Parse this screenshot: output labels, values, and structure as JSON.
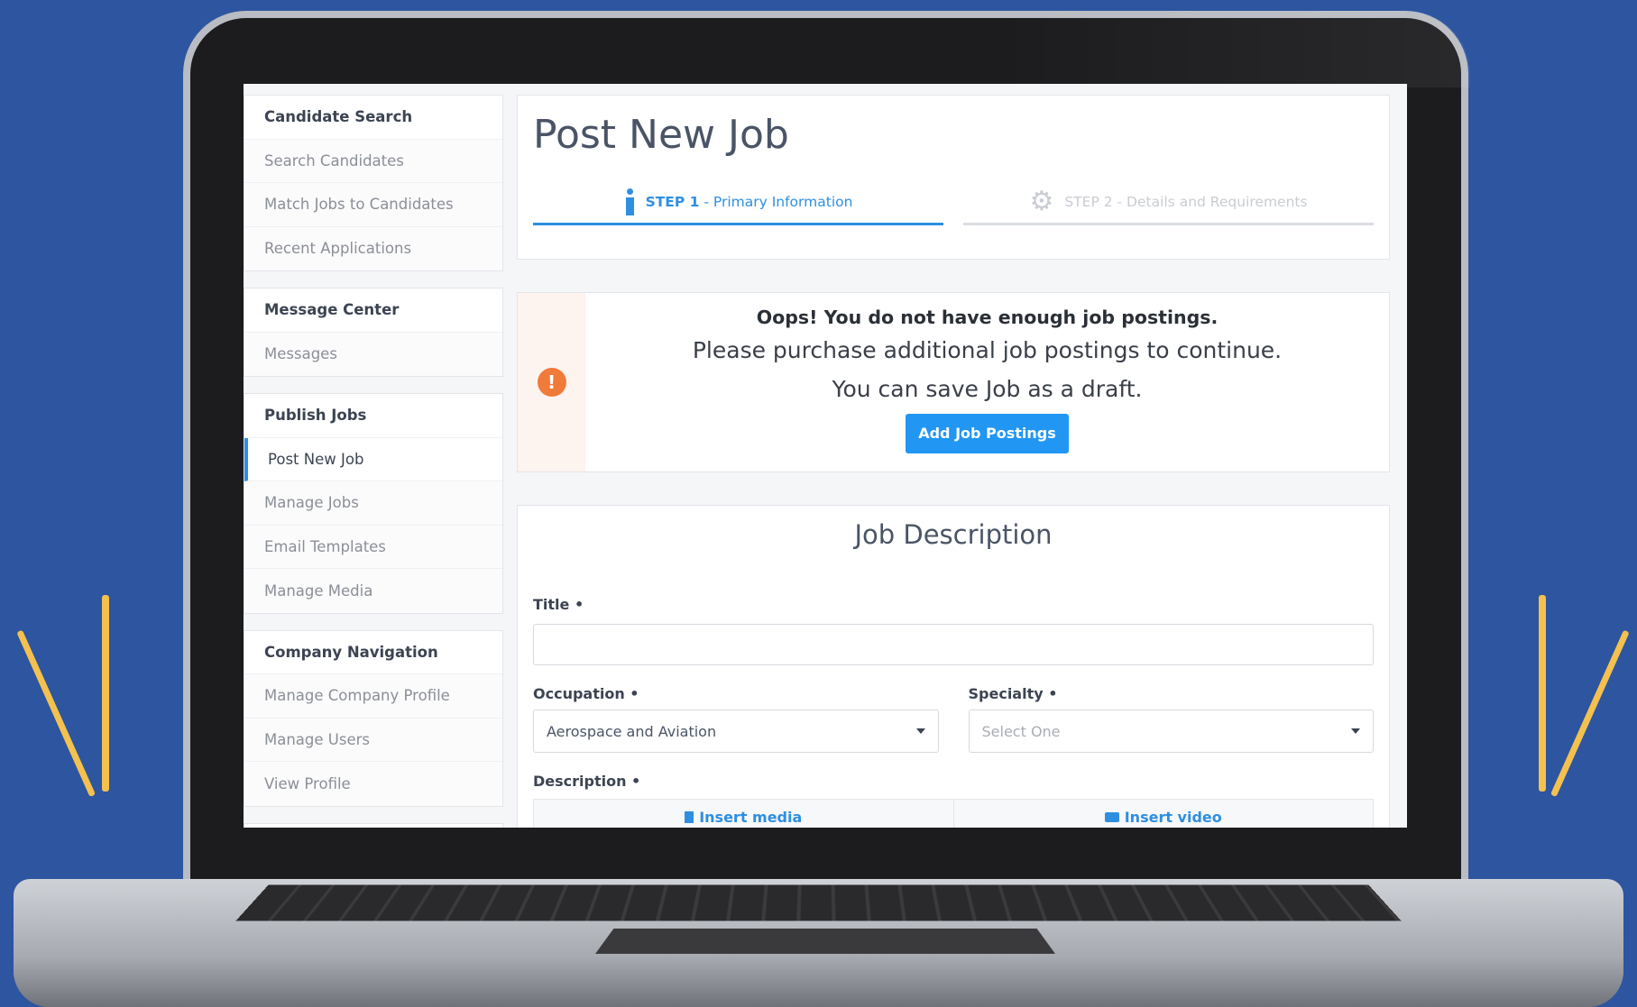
{
  "sidebar": {
    "groups": [
      {
        "header": "Candidate Search",
        "items": [
          "Search Candidates",
          "Match Jobs to Candidates",
          "Recent Applications"
        ]
      },
      {
        "header": "Message Center",
        "items": [
          "Messages"
        ]
      },
      {
        "header": "Publish Jobs",
        "items": [
          "Post New Job",
          "Manage Jobs",
          "Email Templates",
          "Manage Media"
        ]
      },
      {
        "header": "Company Navigation",
        "items": [
          "Manage Company Profile",
          "Manage Users",
          "View Profile"
        ]
      }
    ]
  },
  "main": {
    "title": "Post New Job",
    "steps": [
      {
        "num": "STEP 1",
        "label": " - Primary Information"
      },
      {
        "num": "STEP 2",
        "label": " - Details and Requirements"
      }
    ],
    "alert": {
      "line1": "Oops! You do not have enough job postings.",
      "line2": "Please purchase additional job postings to continue.",
      "line3": "You can save Job as a draft.",
      "button": "Add Job Postings"
    },
    "form": {
      "section_title": "Job Description",
      "title_label": "Title •",
      "occupation_label": "Occupation •",
      "occupation_value": "Aerospace and Aviation",
      "specialty_label": "Specialty •",
      "specialty_placeholder": "Select One",
      "description_label": "Description •",
      "insert_media": "Insert media",
      "insert_video": "Insert video"
    }
  },
  "colors": {
    "accent": "#2e8fe0",
    "warning": "#f07a3a",
    "background": "#2d55a0",
    "rays": "#f4c14e"
  }
}
